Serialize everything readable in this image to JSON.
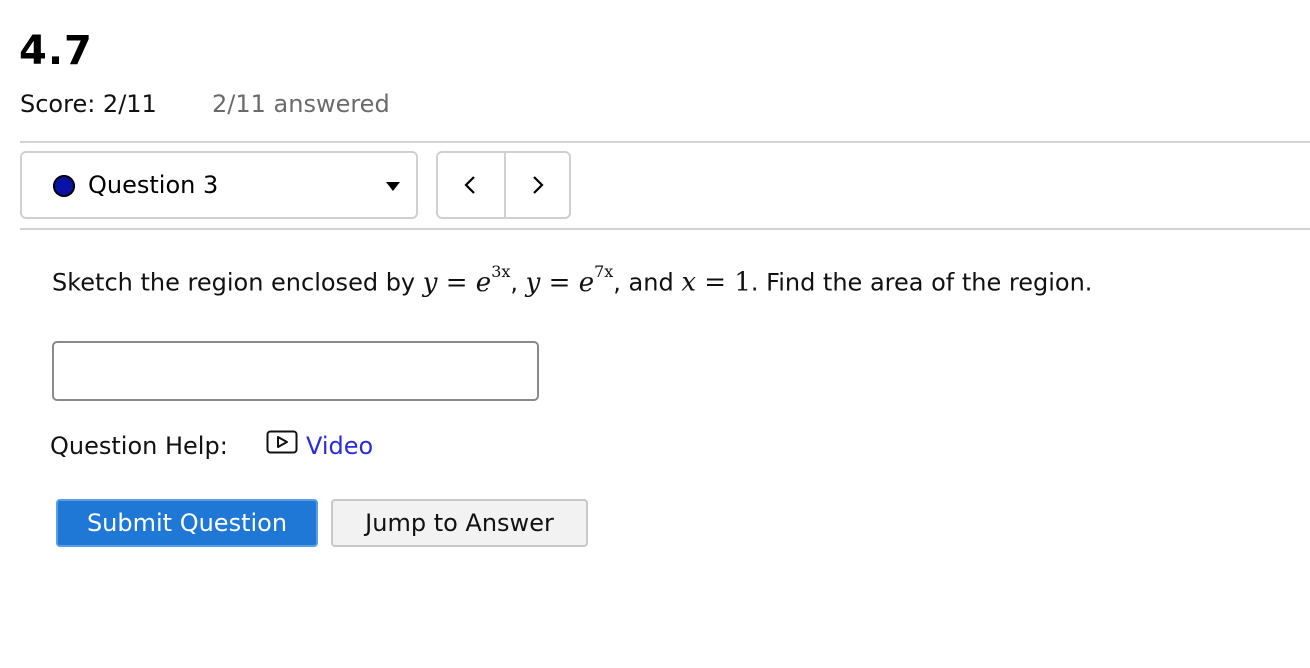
{
  "header": {
    "title": "4.7",
    "score_text": "Score: 2/11",
    "answered_text": "2/11 answered"
  },
  "question_nav": {
    "selected_label": "Question 3",
    "status_color": "#0a12a6",
    "prev_icon": "chevron-left-icon",
    "next_icon": "chevron-right-icon"
  },
  "question": {
    "text_before": "Sketch the region enclosed by ",
    "eq1_lhs": "y",
    "eq1_op": " = ",
    "eq1_base": "e",
    "eq1_exp": "3x",
    "sep1": ", ",
    "eq2_lhs": "y",
    "eq2_op": " = ",
    "eq2_base": "e",
    "eq2_exp": "7x",
    "sep2": ", and ",
    "eq3_lhs": "x",
    "eq3_op": " = ",
    "eq3_rhs": "1",
    "text_after": ". Find the area of the region."
  },
  "answer": {
    "value": "",
    "placeholder": ""
  },
  "help": {
    "label": "Question Help:",
    "video_label": "Video",
    "video_icon": "video-play-icon"
  },
  "actions": {
    "submit_label": "Submit Question",
    "jump_label": "Jump to Answer"
  },
  "colors": {
    "submit_bg": "#1f78d6",
    "link": "#2a2cd6"
  }
}
